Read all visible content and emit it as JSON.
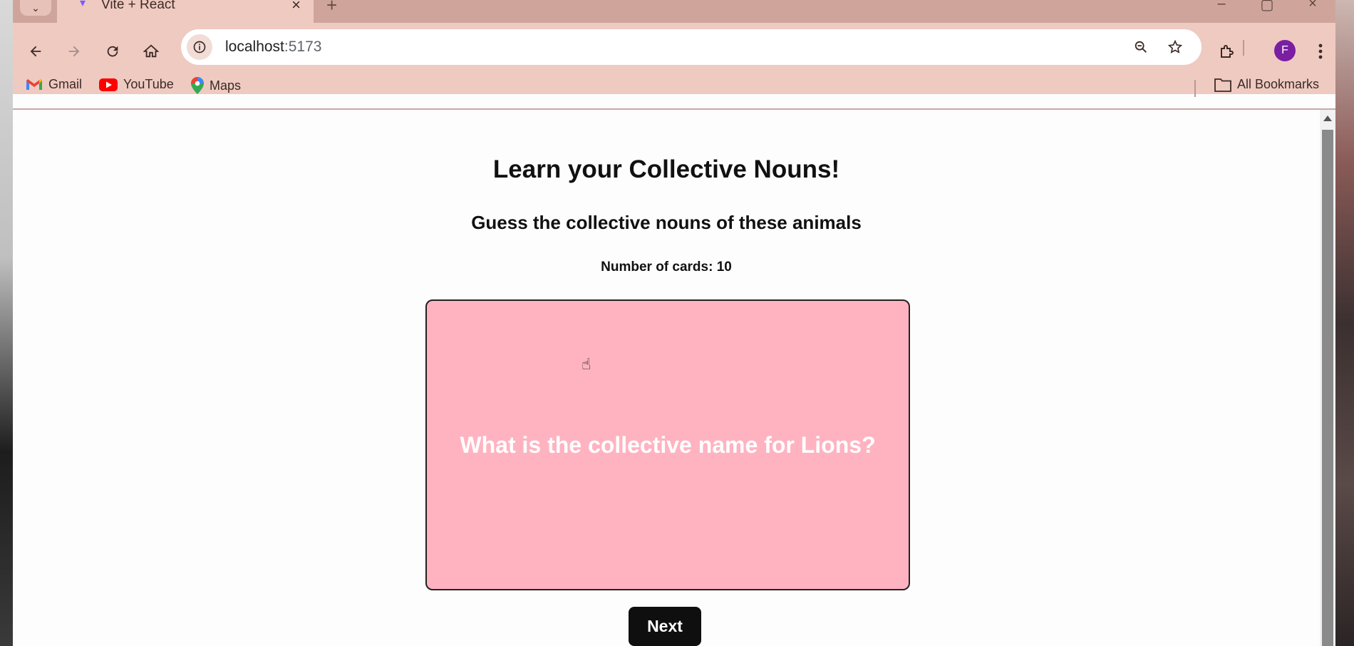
{
  "browser": {
    "tab": {
      "title": "Vite + React",
      "close_glyph": "×"
    },
    "new_tab_glyph": "+",
    "window_controls": [
      "–",
      "▢",
      "×"
    ],
    "address": {
      "host": "localhost",
      "port": ":5173"
    },
    "profile_initial": "F",
    "bookmarks": [
      {
        "label": "Gmail",
        "icon": "gmail-icon"
      },
      {
        "label": "YouTube",
        "icon": "youtube-icon"
      },
      {
        "label": "Maps",
        "icon": "maps-icon"
      }
    ],
    "all_bookmarks_label": "All Bookmarks"
  },
  "page": {
    "title": "Learn your Collective Nouns!",
    "subtitle": "Guess the collective nouns of these animals",
    "card_count_label": "Number of cards: 10",
    "card": {
      "question": "What is the collective name for Lions?",
      "color": "#ffb3c0"
    },
    "next_label": "Next"
  }
}
